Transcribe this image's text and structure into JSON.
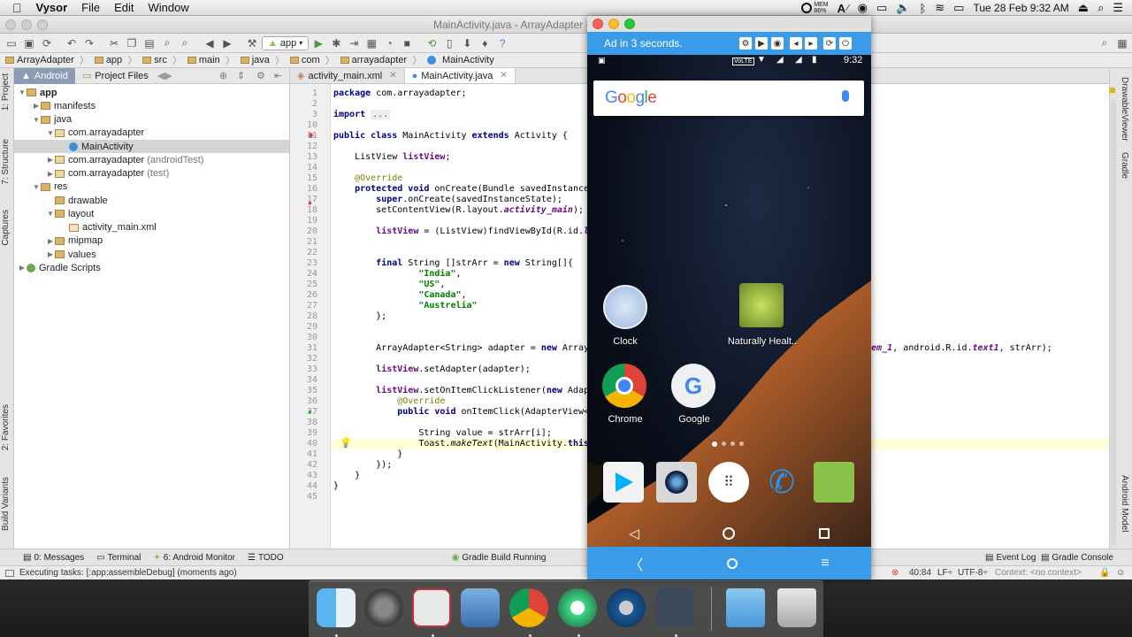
{
  "menubar": {
    "apple": "",
    "app_name": "Vysor",
    "items": [
      "File",
      "Edit",
      "Window"
    ],
    "mem_label": "MEM",
    "mem_value": "86%",
    "input_source": "A",
    "clock": "Tue 28 Feb  9:32 AM"
  },
  "window": {
    "title": "MainActivity.java - ArrayAdapter -"
  },
  "toolbar": {
    "run_config": "app"
  },
  "breadcrumb": [
    "ArrayAdapter",
    "app",
    "src",
    "main",
    "java",
    "com",
    "arrayadapter",
    "MainActivity"
  ],
  "left_tabs": [
    "1: Project",
    "7: Structure",
    "Captures",
    "2: Favorites",
    "Build Variants"
  ],
  "project": {
    "tabs": [
      "Android",
      "Project Files"
    ],
    "tree": [
      {
        "label": "app",
        "dim": "",
        "icon": "folder",
        "arrow": "▼",
        "indent": 0,
        "bold": true
      },
      {
        "label": "manifests",
        "dim": "",
        "icon": "folder",
        "arrow": "▶",
        "indent": 1
      },
      {
        "label": "java",
        "dim": "",
        "icon": "folder",
        "arrow": "▼",
        "indent": 1
      },
      {
        "label": "com.arrayadapter",
        "dim": "",
        "icon": "pkg",
        "arrow": "▼",
        "indent": 2
      },
      {
        "label": "MainActivity",
        "dim": "",
        "icon": "cls",
        "arrow": "",
        "indent": 3,
        "selected": true
      },
      {
        "label": "com.arrayadapter",
        "dim": "(androidTest)",
        "icon": "pkg",
        "arrow": "▶",
        "indent": 2
      },
      {
        "label": "com.arrayadapter",
        "dim": "(test)",
        "icon": "pkg",
        "arrow": "▶",
        "indent": 2
      },
      {
        "label": "res",
        "dim": "",
        "icon": "folder",
        "arrow": "▼",
        "indent": 1
      },
      {
        "label": "drawable",
        "dim": "",
        "icon": "folder",
        "arrow": "",
        "indent": 2
      },
      {
        "label": "layout",
        "dim": "",
        "icon": "folder",
        "arrow": "▼",
        "indent": 2
      },
      {
        "label": "activity_main.xml",
        "dim": "",
        "icon": "xml",
        "arrow": "",
        "indent": 3
      },
      {
        "label": "mipmap",
        "dim": "",
        "icon": "folder",
        "arrow": "▶",
        "indent": 2
      },
      {
        "label": "values",
        "dim": "",
        "icon": "folder",
        "arrow": "▶",
        "indent": 2
      },
      {
        "label": "Gradle Scripts",
        "dim": "",
        "icon": "gradle",
        "arrow": "▶",
        "indent": 0
      }
    ]
  },
  "editor": {
    "tabs": [
      {
        "label": "activity_main.xml",
        "active": false
      },
      {
        "label": "MainActivity.java",
        "active": true
      }
    ],
    "lines": [
      {
        "n": "1",
        "html": "<span class='kw'>package</span> com.arrayadapter;"
      },
      {
        "n": "2",
        "html": ""
      },
      {
        "n": "3",
        "html": "<span class='kw'>import</span> <span class='fold-code'>...</span>"
      },
      {
        "n": "10",
        "html": ""
      },
      {
        "n": "11",
        "html": "<span class='kw'>public class</span> MainActivity <span class='kw'>extends</span> Activity {"
      },
      {
        "n": "12",
        "html": ""
      },
      {
        "n": "13",
        "html": "    ListView <span class='fld'>listView</span>;"
      },
      {
        "n": "14",
        "html": ""
      },
      {
        "n": "15",
        "html": "    <span class='ann'>@Override</span>"
      },
      {
        "n": "16",
        "html": "    <span class='kw'>protected void</span> onCreate(Bundle savedInstanceState) {"
      },
      {
        "n": "17",
        "html": "        <span class='kw'>super</span>.onCreate(savedInstanceState);"
      },
      {
        "n": "18",
        "html": "        setContentView(R.layout.<span class='fld it'>activity_main</span>);"
      },
      {
        "n": "19",
        "html": ""
      },
      {
        "n": "20",
        "html": "        <span class='fld'>listView</span> = (ListView)findViewById(R.id.<span class='fld it'>list</span>);"
      },
      {
        "n": "21",
        "html": ""
      },
      {
        "n": "22",
        "html": ""
      },
      {
        "n": "23",
        "html": "        <span class='kw'>final</span> String []strArr = <span class='kw'>new</span> String[]{"
      },
      {
        "n": "24",
        "html": "                <span class='str'>\"India\"</span>,"
      },
      {
        "n": "25",
        "html": "                <span class='str'>\"US\"</span>,"
      },
      {
        "n": "26",
        "html": "                <span class='str'>\"Canada\"</span>,"
      },
      {
        "n": "27",
        "html": "                <span class='str'>\"Austrelia\"</span>"
      },
      {
        "n": "28",
        "html": "        };"
      },
      {
        "n": "29",
        "html": ""
      },
      {
        "n": "30",
        "html": ""
      },
      {
        "n": "31",
        "html": "        ArrayAdapter&lt;String&gt; adapter = <span class='kw'>new</span> ArrayAdapter&lt;String&gt;(<span class='kw'>this</span>, android.R.layout.<span class='fld it'>simple_list_item_1</span>, android.R.id.<span class='fld it'>text1</span>, strArr);"
      },
      {
        "n": "32",
        "html": ""
      },
      {
        "n": "33",
        "html": "        <span class='fld'>listView</span>.setAdapter(adapter);"
      },
      {
        "n": "34",
        "html": ""
      },
      {
        "n": "35",
        "html": "        <span class='fld'>listView</span>.setOnItemClickListener(<span class='kw'>new</span> AdapterView.OnItemClickListener() {"
      },
      {
        "n": "36",
        "html": "            <span class='ann'>@Override</span>"
      },
      {
        "n": "37",
        "html": "            <span class='kw'>public void</span> onItemClick(AdapterView&lt;?&gt; parent, View view, <span class='kw'>int</span> i, <span class='kw'>long</span> l) {"
      },
      {
        "n": "38",
        "html": ""
      },
      {
        "n": "39",
        "html": "                String value = strArr[i];"
      },
      {
        "n": "40",
        "html": "                Toast.<span class='it'>makeText</span>(MainActivity.<span class='kw'>this</span>, value, Toast.<span class='fld it'>LENGTH_SHORT</span>).show();"
      },
      {
        "n": "41",
        "html": "            }"
      },
      {
        "n": "42",
        "html": "        });"
      },
      {
        "n": "43",
        "html": "    }"
      },
      {
        "n": "44",
        "html": "}"
      },
      {
        "n": "45",
        "html": ""
      }
    ]
  },
  "right_tabs": [
    "DrawableViewer",
    "Gradle",
    "Android Model"
  ],
  "bottom_tabs": [
    {
      "label": "0: Messages",
      "icon": "messages-icon",
      "glyph": "▤"
    },
    {
      "label": "Terminal",
      "icon": "terminal-icon",
      "glyph": "▭"
    },
    {
      "label": "6: Android Monitor",
      "icon": "android-monitor-icon",
      "glyph": "✦"
    },
    {
      "label": "TODO",
      "icon": "todo-icon",
      "glyph": "☰"
    }
  ],
  "bottom_center": "Gradle Build Running",
  "bottom_right": [
    "Event Log",
    "Gradle Console"
  ],
  "status": {
    "message": "Executing tasks: [:app:assembleDebug] (moments ago)",
    "position": "40:84",
    "line_sep": "LF÷",
    "encoding": "UTF-8÷",
    "context": "Context: <no context>"
  },
  "vysor": {
    "ad_text": "Ad in 3 seconds.",
    "phone_time": "9:32",
    "network": "VoLTE",
    "search_logo": "Google",
    "apps": [
      {
        "name": "Clock",
        "color": "#9ab8e0"
      },
      {
        "name": "Naturally Healt..",
        "color": "#8aa838"
      },
      {
        "name": "Chrome",
        "color": "#db4437"
      },
      {
        "name": "Google",
        "color": "#e0e0e0"
      }
    ],
    "dock_apps": [
      "Play Store",
      "Camera",
      "App Drawer",
      "Phone",
      "Messages"
    ],
    "nav": [
      "back",
      "home",
      "recents"
    ],
    "vysor_nav": [
      "back",
      "home",
      "menu"
    ]
  },
  "dock": [
    "Finder",
    "System Preferences",
    "Pages",
    "Preview",
    "Chrome",
    "Android Studio",
    "QuickTime",
    "Vysor",
    "Downloads",
    "Trash"
  ]
}
